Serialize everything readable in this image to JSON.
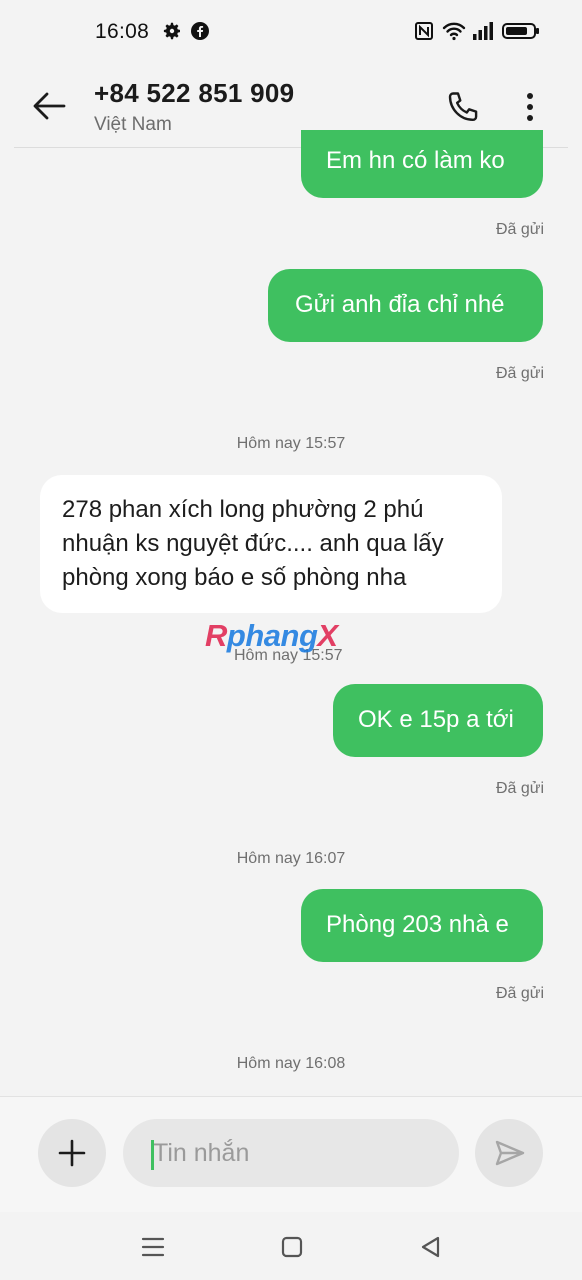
{
  "status_bar": {
    "time": "16:08",
    "left_icons": [
      "gear-icon",
      "facebook-icon"
    ],
    "right_icons": [
      "nfc-icon",
      "wifi-icon",
      "signal-icon",
      "battery-icon"
    ]
  },
  "header": {
    "contact_number": "+84 522 851 909",
    "contact_country": "Việt Nam",
    "icons": [
      "back-arrow-icon",
      "phone-icon",
      "more-vert-icon"
    ]
  },
  "messages": [
    {
      "direction": "outgoing",
      "text": "Em hn có làm ko",
      "status": "Đã gửi"
    },
    {
      "direction": "outgoing",
      "text": "Gửi anh đỉa chỉ nhé",
      "status": "Đã gửi"
    },
    {
      "timestamp": "Hôm nay 15:57"
    },
    {
      "direction": "incoming",
      "text": "278 phan xích long phường 2 phú nhuận ks nguyệt đức.... anh qua lấy phòng xong báo e số phòng nha",
      "time": "Hôm nay 15:57"
    },
    {
      "direction": "outgoing",
      "text": "OK e 15p a tới",
      "status": "Đã gửi"
    },
    {
      "timestamp": "Hôm nay 16:07"
    },
    {
      "direction": "outgoing",
      "text": "Phòng 203 nhà e",
      "status": "Đã gửi"
    },
    {
      "timestamp": "Hôm nay 16:08"
    }
  ],
  "watermark": {
    "part_a": "R",
    "part_b": "phang",
    "part_c": "X"
  },
  "composer": {
    "placeholder": "Tin nhắn",
    "icons": [
      "plus-icon",
      "send-icon"
    ]
  },
  "nav_bar": {
    "icons": [
      "menu-icon",
      "home-square-icon",
      "back-triangle-icon"
    ]
  },
  "colors": {
    "outgoing_bubble": "#3fc060",
    "incoming_bubble": "#ffffff",
    "background": "#f3f3f3"
  }
}
